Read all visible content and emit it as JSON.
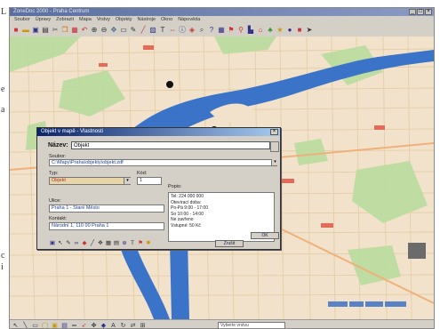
{
  "margin": {
    "marks": [
      "L",
      "e",
      "a",
      "c",
      "i"
    ]
  },
  "window": {
    "title": "ZoneDoc 2000 - Praha Centrum",
    "menu": [
      "Soubor",
      "Úpravy",
      "Zobrazit",
      "Mapa",
      "Vrstvy",
      "Objekty",
      "Nástroje",
      "Okno",
      "Nápověda"
    ]
  },
  "toolbar": {
    "icons": [
      "new-icon",
      "open-icon",
      "save-icon",
      "print-icon",
      "cut-icon",
      "copy-icon",
      "paste-icon",
      "undo-icon",
      "zoom-in-icon",
      "zoom-out-icon",
      "pan-icon",
      "select-icon",
      "pen-icon",
      "line-icon",
      "area-icon",
      "text-icon",
      "measure-icon",
      "info-icon",
      "layers-icon",
      "search-icon",
      "help-icon"
    ]
  },
  "dialog": {
    "title": "Objekt v mapě - Vlastnosti",
    "name_label": "Název:",
    "name_value": "Objekt",
    "file_label": "Soubor:",
    "file_value": "C:\\Mapy\\Praha\\objekty\\objekt.zdf",
    "type_label": "Typ:",
    "type_value": "Objekt",
    "code_label": "Kód:",
    "code_value": "1",
    "street_label": "Ulice:",
    "street_value": "Praha 1 - Staré Město",
    "contact_label": "Kontakt:",
    "contact_value": "Národní 1, 110 00 Praha 1",
    "description_label": "Popis:",
    "description_lines": [
      "Tel: 224 000 000",
      "Otevírací doba:",
      "Po-Pá 9:00 - 17:00",
      "So 10:00 - 14:00",
      "Ne zavřeno",
      "Vstupné: 50 Kč"
    ],
    "ok_label": "OK",
    "cancel_label": "Zrušit"
  },
  "statusbar": {
    "select_value": "Vyberte vrstvu"
  }
}
